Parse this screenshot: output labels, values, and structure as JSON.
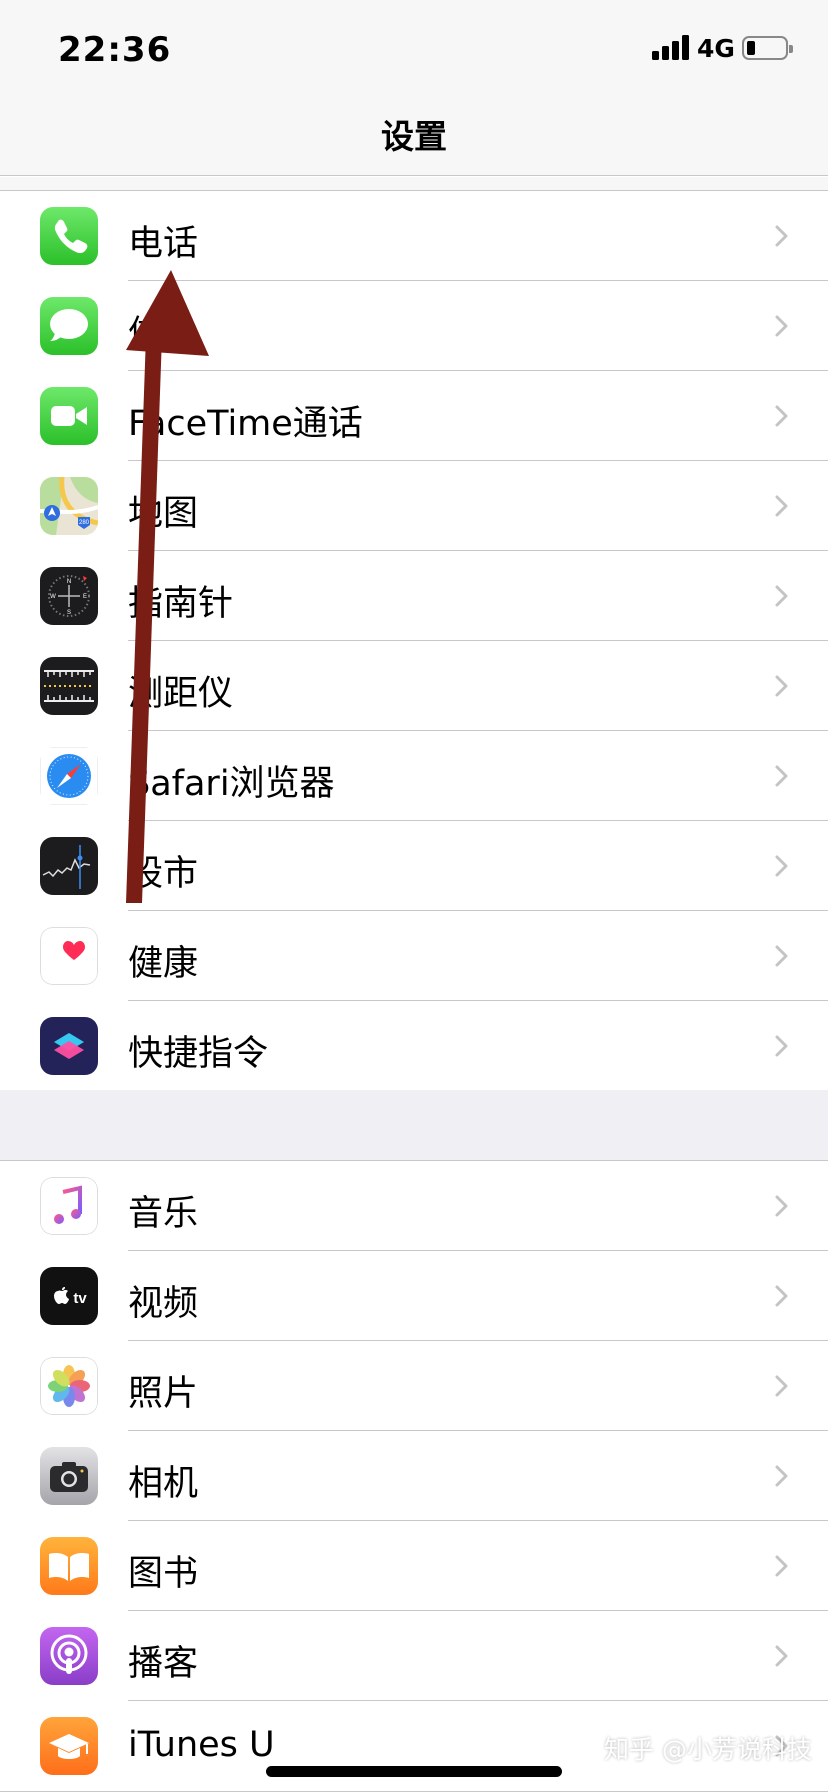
{
  "status": {
    "time": "22:36",
    "network": "4G"
  },
  "nav": {
    "title": "设置"
  },
  "groups": [
    {
      "items": [
        {
          "label": "电话",
          "icon": "phone-icon",
          "color": "#4cd964"
        },
        {
          "label": "信息",
          "icon": "messages-icon",
          "color": "#4cd964"
        },
        {
          "label": "FaceTime通话",
          "icon": "facetime-icon",
          "color": "#4cd964"
        },
        {
          "label": "地图",
          "icon": "maps-icon",
          "color": "#b8e0a8"
        },
        {
          "label": "指南针",
          "icon": "compass-icon",
          "color": "#1c1c1e"
        },
        {
          "label": "测距仪",
          "icon": "measure-icon",
          "color": "#1c1c1e"
        },
        {
          "label": "Safari浏览器",
          "icon": "safari-icon",
          "color": "#1e88e5"
        },
        {
          "label": "股市",
          "icon": "stocks-icon",
          "color": "#1c1c1e"
        },
        {
          "label": "健康",
          "icon": "health-icon",
          "color": "#ff2d55"
        },
        {
          "label": "快捷指令",
          "icon": "shortcuts-icon",
          "color": "#2c2c6e"
        }
      ]
    },
    {
      "items": [
        {
          "label": "音乐",
          "icon": "music-icon",
          "color": "#fc3c44"
        },
        {
          "label": "视频",
          "icon": "tv-icon",
          "color": "#000000"
        },
        {
          "label": "照片",
          "icon": "photos-icon",
          "color": "#ff9500"
        },
        {
          "label": "相机",
          "icon": "camera-icon",
          "color": "#8e8e93"
        },
        {
          "label": "图书",
          "icon": "books-icon",
          "color": "#ff9500"
        },
        {
          "label": "播客",
          "icon": "podcasts-icon",
          "color": "#9b59d0"
        },
        {
          "label": "iTunes U",
          "icon": "itunes-u-icon",
          "color": "#ff8a00"
        }
      ]
    }
  ],
  "annotation": {
    "arrow_color": "#7a1d14"
  },
  "watermark": "知乎 @小芳说科技"
}
